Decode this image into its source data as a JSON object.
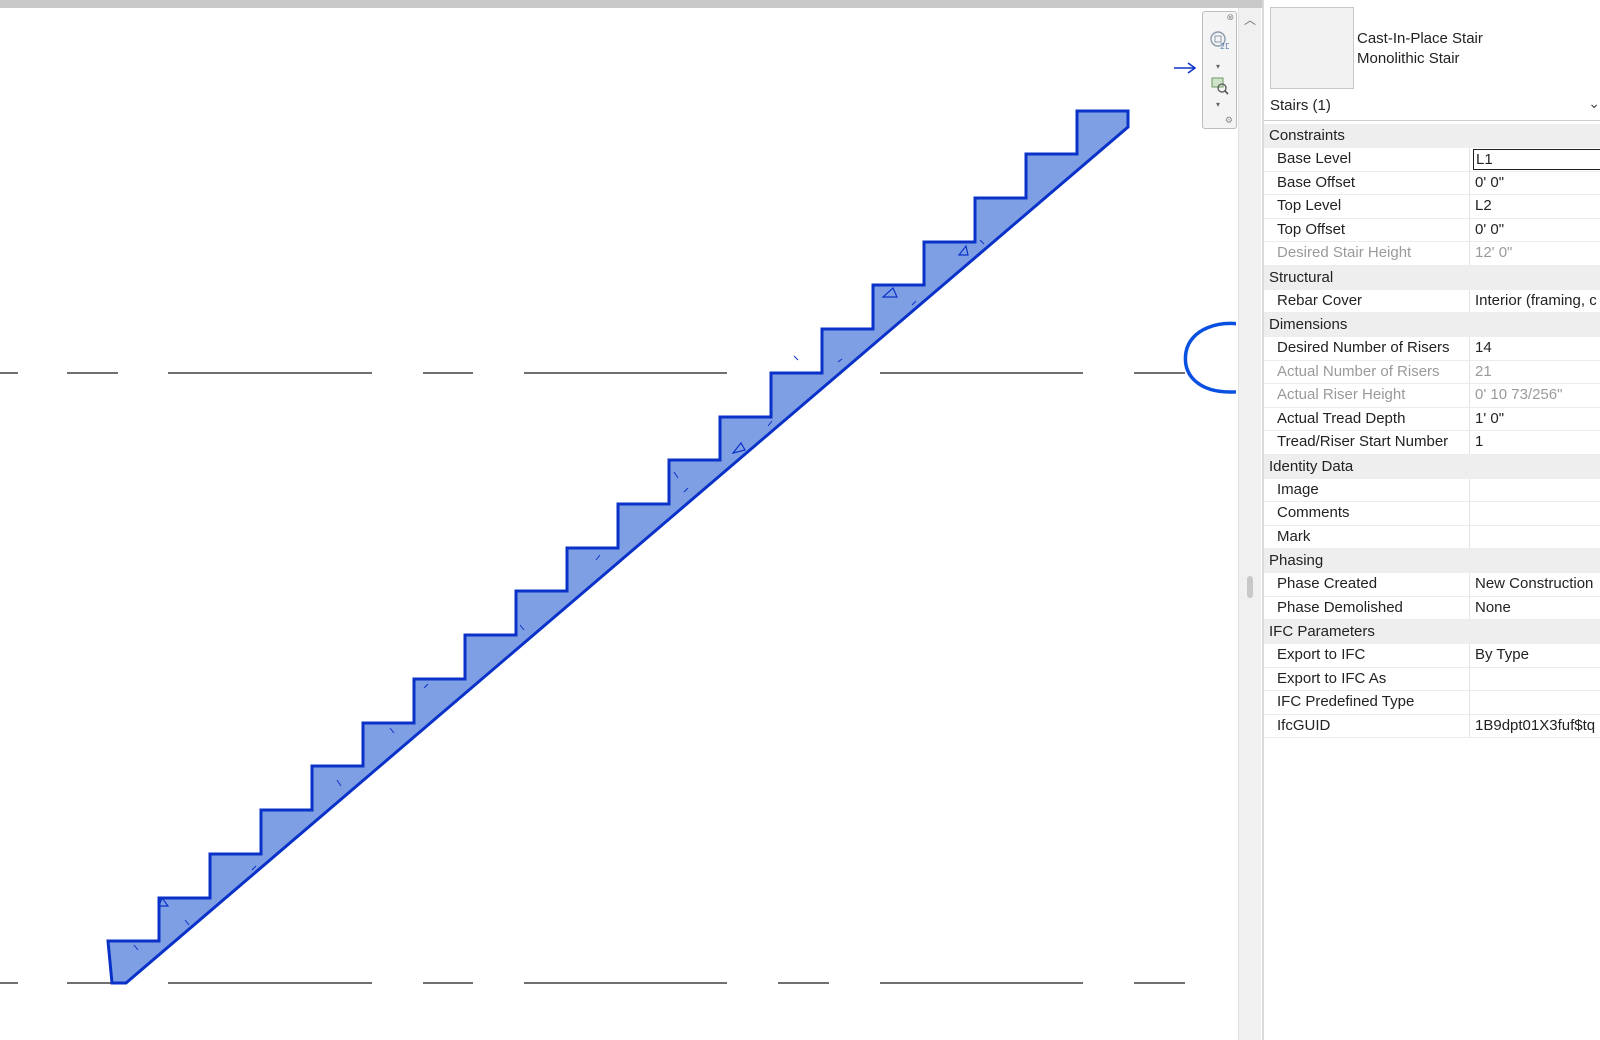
{
  "colors": {
    "stair_fill": "#7f9fe4",
    "stair_stroke": "#0a32c8",
    "annotation": "#0a50e0",
    "group_bg": "#eeeeee",
    "disabled_text": "#9a9a9a"
  },
  "viewport": {
    "navbar_icons": [
      "zoom-2d-icon",
      "zoom-region-icon"
    ]
  },
  "type_selector": {
    "family": "Cast-In-Place Stair",
    "type": "Monolithic Stair"
  },
  "instance_selector": {
    "label": "Stairs (1)",
    "icon": "chevron-down-icon"
  },
  "properties": {
    "constraints": {
      "title": "Constraints",
      "base_level": {
        "label": "Base Level",
        "value": "L1"
      },
      "base_offset": {
        "label": "Base Offset",
        "value": "0'  0\""
      },
      "top_level": {
        "label": "Top Level",
        "value": "L2"
      },
      "top_offset": {
        "label": "Top Offset",
        "value": "0'  0\""
      },
      "desired_stair_height": {
        "label": "Desired Stair Height",
        "value": "12'  0\""
      }
    },
    "structural": {
      "title": "Structural",
      "rebar_cover": {
        "label": "Rebar Cover",
        "value": "Interior (framing, c"
      }
    },
    "dimensions": {
      "title": "Dimensions",
      "desired_risers": {
        "label": "Desired Number of Risers",
        "value": "14"
      },
      "actual_risers": {
        "label": "Actual Number of Risers",
        "value": "21"
      },
      "actual_riser_height": {
        "label": "Actual Riser Height",
        "value": "0'  10 73/256\""
      },
      "actual_tread_depth": {
        "label": "Actual Tread Depth",
        "value": "1'  0\""
      },
      "tread_riser_start": {
        "label": "Tread/Riser Start Number",
        "value": "1"
      }
    },
    "identity": {
      "title": "Identity Data",
      "image": {
        "label": "Image",
        "value": ""
      },
      "comments": {
        "label": "Comments",
        "value": ""
      },
      "mark": {
        "label": "Mark",
        "value": ""
      }
    },
    "phasing": {
      "title": "Phasing",
      "phase_created": {
        "label": "Phase Created",
        "value": "New Construction"
      },
      "phase_demolished": {
        "label": "Phase Demolished",
        "value": "None"
      }
    },
    "ifc": {
      "title": "IFC Parameters",
      "export_to_ifc": {
        "label": "Export to IFC",
        "value": "By Type"
      },
      "export_to_ifc_as": {
        "label": "Export to IFC As",
        "value": ""
      },
      "ifc_predefined_type": {
        "label": "IFC Predefined Type",
        "value": ""
      },
      "ifc_guid": {
        "label": "IfcGUID",
        "value": "1B9dpt01X3fuf$tq"
      }
    }
  }
}
